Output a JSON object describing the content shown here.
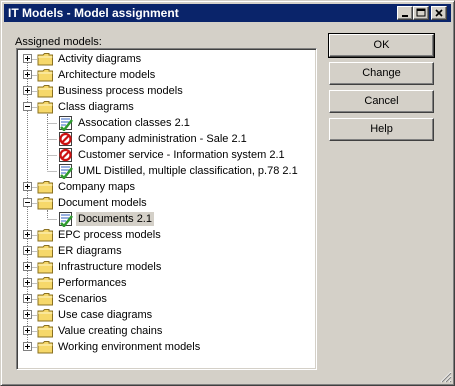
{
  "window": {
    "title": "IT Models - Model assignment"
  },
  "assigned_label": "Assigned models:",
  "tree": [
    {
      "label": "Activity diagrams",
      "depth": 0,
      "icon": "folder-icon",
      "expander": "plus"
    },
    {
      "label": "Architecture models",
      "depth": 0,
      "icon": "folder-icon",
      "expander": "plus"
    },
    {
      "label": "Business process models",
      "depth": 0,
      "icon": "folder-icon",
      "expander": "plus"
    },
    {
      "label": "Class diagrams",
      "depth": 0,
      "icon": "folder-icon",
      "expander": "minus"
    },
    {
      "label": "Assocation classes 2.1",
      "depth": 1,
      "icon": "model-check-icon",
      "expander": ""
    },
    {
      "label": "Company administration - Sale 2.1",
      "depth": 1,
      "icon": "model-forbidden-icon",
      "expander": ""
    },
    {
      "label": "Customer service - Information system 2.1",
      "depth": 1,
      "icon": "model-forbidden-icon",
      "expander": ""
    },
    {
      "label": "UML Distilled, multiple classification, p.78 2.1",
      "depth": 1,
      "icon": "model-check-icon",
      "expander": ""
    },
    {
      "label": "Company maps",
      "depth": 0,
      "icon": "folder-icon",
      "expander": "plus"
    },
    {
      "label": "Document models",
      "depth": 0,
      "icon": "folder-icon",
      "expander": "minus"
    },
    {
      "label": "Documents 2.1",
      "depth": 1,
      "icon": "model-check-icon",
      "expander": "",
      "selected": true
    },
    {
      "label": "EPC process models",
      "depth": 0,
      "icon": "folder-icon",
      "expander": "plus"
    },
    {
      "label": "ER diagrams",
      "depth": 0,
      "icon": "folder-icon",
      "expander": "plus"
    },
    {
      "label": "Infrastructure models",
      "depth": 0,
      "icon": "folder-icon",
      "expander": "plus"
    },
    {
      "label": "Performances",
      "depth": 0,
      "icon": "folder-icon",
      "expander": "plus"
    },
    {
      "label": "Scenarios",
      "depth": 0,
      "icon": "folder-icon",
      "expander": "plus"
    },
    {
      "label": "Use case diagrams",
      "depth": 0,
      "icon": "folder-icon",
      "expander": "plus"
    },
    {
      "label": "Value creating chains",
      "depth": 0,
      "icon": "folder-icon",
      "expander": "plus"
    },
    {
      "label": "Working environment models",
      "depth": 0,
      "icon": "folder-icon",
      "expander": "plus"
    }
  ],
  "buttons": {
    "ok": "OK",
    "change": "Change",
    "cancel": "Cancel",
    "help": "Help"
  },
  "colors": {
    "titlebar": "#0a246a",
    "face": "#d4d0c8",
    "folder": "#f6d86a",
    "check": "#2e9a2e",
    "forbidden": "#cc1111"
  }
}
